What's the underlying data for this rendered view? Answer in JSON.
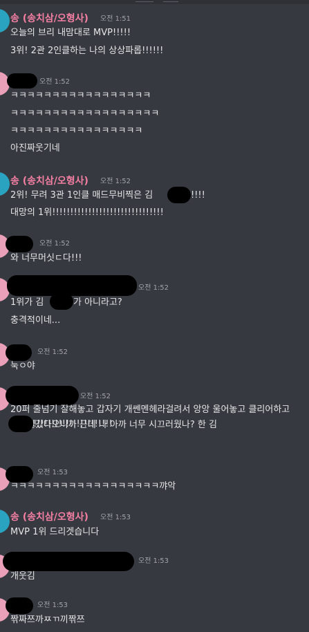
{
  "messages": [
    {
      "author": "송 (송치삼/오형사)",
      "time": "오전 1:51",
      "lines": [
        "오늘의 브리 내맘대로 MVP!!!!!",
        "3위! 2관 2인클하는 나의 상상파롭!!!!!!"
      ]
    },
    {
      "author": "",
      "time": "오전 1:52",
      "lines": [
        "ㅋㅋㅋㅋㅋㅋㅋㅋㅋㅋㅋㅋㅋㅋㅋㅋㅋ",
        "ㅋㅋㅋㅋㅋㅋㅋㅋㅋㅋㅋㅋㅋㅋㅋㅋㅋㅋ",
        "ㅋㅋㅋㅋㅋㅋㅋㅋㅋㅋㅋㅋㅋㅋㅋㅋ",
        "아진짜웃기네"
      ]
    },
    {
      "author": "송 (송치삼/오형사)",
      "time": "오전 1:52",
      "lines": [
        "2위! 무려 3관 1인클 매드무비찍은 김",
        "!!!!",
        "대망의 1위!!!!!!!!!!!!!!!!!!!!!!!!!!!!!!!"
      ]
    },
    {
      "author": "",
      "time": "오전 1:52",
      "lines": [
        "와 너무머싯ㄷ다!!!"
      ]
    },
    {
      "author": "",
      "time": "오전 1:52",
      "lines": [
        "1위가 김",
        "가 아니라고?",
        "충격적이네..."
      ]
    },
    {
      "author": "",
      "time": "오전 1:52",
      "lines": [
        "눅ㅇ야"
      ]
    },
    {
      "author": "",
      "time": "오전 1:52",
      "lines": [
        "20퍼 줄넘기 잘해놓고 갑자기 개쎈멘헤라걸려서 앙앙 울어놓고 클리어하고 화장실갔다오니까 근데 나 아까 너무 시끄러웠나? 한 김",
        "!!!!!!!!!!!!!!!!!!!!!!"
      ]
    },
    {
      "author": "",
      "time": "오전 1:53",
      "lines": [
        "ㅋㅋㅋㅋㅋㅋㅋㅋㅋㅋㅋㅋㅋㅋㅋㅋㅋㅋ꺄악"
      ]
    },
    {
      "author": "송 (송치삼/오형사)",
      "time": "오전 1:53",
      "lines": [
        "MVP 1위 드리겟습니다"
      ]
    },
    {
      "author": "",
      "time": "오전 1:53",
      "lines": [
        "개웃김"
      ]
    },
    {
      "author": "",
      "time": "오전 1:53",
      "lines": [
        "짞짜쯔까ㅉㄲ끼짞쯔"
      ]
    }
  ]
}
